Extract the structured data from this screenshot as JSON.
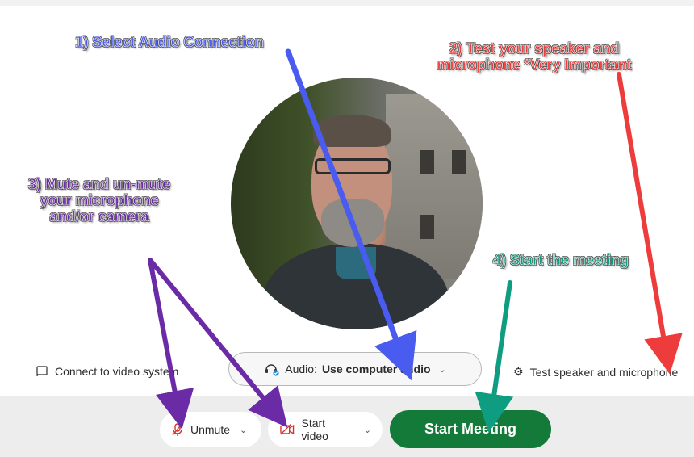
{
  "controls": {
    "connect_video": "Connect to video system",
    "audio_label": "Audio:",
    "audio_value": "Use computer audio",
    "test_speaker": "Test speaker and microphone",
    "unmute": "Unmute",
    "start_video": "Start video",
    "start_meeting": "Start Meeting"
  },
  "annotations": {
    "a1": "1) Select Audio Connection",
    "a2": "2) Test your speaker and microphone *Very Important",
    "a3": "3) Mute and un-mute your microphone and/or camera",
    "a4": "4) Start the meeting"
  },
  "colors": {
    "start_button": "#137a39",
    "annotation_1": "#4a5bf0",
    "annotation_2": "#ee3b3b",
    "annotation_3": "#6b2aa6",
    "annotation_4": "#0f9d81"
  },
  "icons": {
    "cast": "cast-icon",
    "audio": "headset-icon",
    "settings": "gear-icon",
    "mic_muted": "mic-off-icon",
    "video_off": "video-off-icon",
    "dropdown": "chevron-down-icon"
  }
}
